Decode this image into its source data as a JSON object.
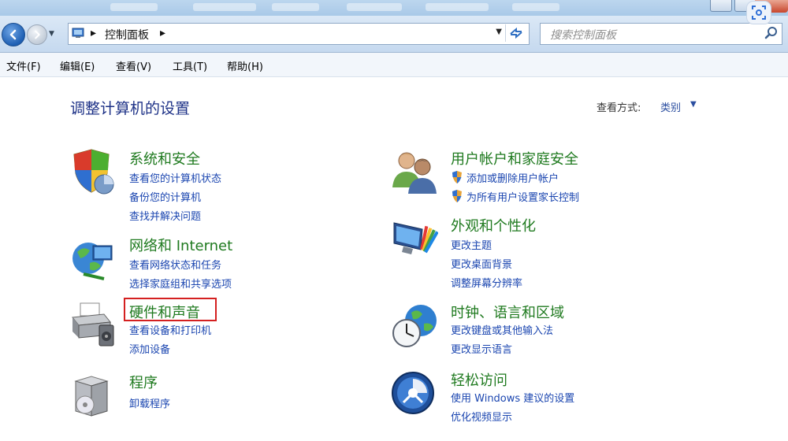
{
  "address": {
    "crumb": "控制面板",
    "search_placeholder": "搜索控制面板"
  },
  "menu": [
    "文件(F)",
    "编辑(E)",
    "查看(V)",
    "工具(T)",
    "帮助(H)"
  ],
  "page": {
    "heading": "调整计算机的设置",
    "view_label": "查看方式:",
    "view_value": "类别"
  },
  "categories_left": [
    {
      "title": "系统和安全",
      "links": [
        "查看您的计算机状态",
        "备份您的计算机",
        "查找并解决问题"
      ]
    },
    {
      "title": "网络和 Internet",
      "links": [
        "查看网络状态和任务",
        "选择家庭组和共享选项"
      ]
    },
    {
      "title": "硬件和声音",
      "links": [
        "查看设备和打印机",
        "添加设备"
      ]
    },
    {
      "title": "程序",
      "links": [
        "卸载程序"
      ]
    }
  ],
  "categories_right": [
    {
      "title": "用户帐户和家庭安全",
      "links": [
        "添加或删除用户帐户",
        "为所有用户设置家长控制"
      ]
    },
    {
      "title": "外观和个性化",
      "links": [
        "更改主题",
        "更改桌面背景",
        "调整屏幕分辨率"
      ]
    },
    {
      "title": "时钟、语言和区域",
      "links": [
        "更改键盘或其他输入法",
        "更改显示语言"
      ]
    },
    {
      "title": "轻松访问",
      "links": [
        "使用 Windows 建议的设置",
        "优化视频显示"
      ]
    }
  ],
  "icons": {
    "system": "shield-icon",
    "network": "network-globe-icon",
    "hardware": "printer-icon",
    "programs": "programs-box-icon",
    "users": "users-icon",
    "appearance": "monitor-palette-icon",
    "clock": "clock-globe-icon",
    "ease": "ease-of-access-icon"
  }
}
